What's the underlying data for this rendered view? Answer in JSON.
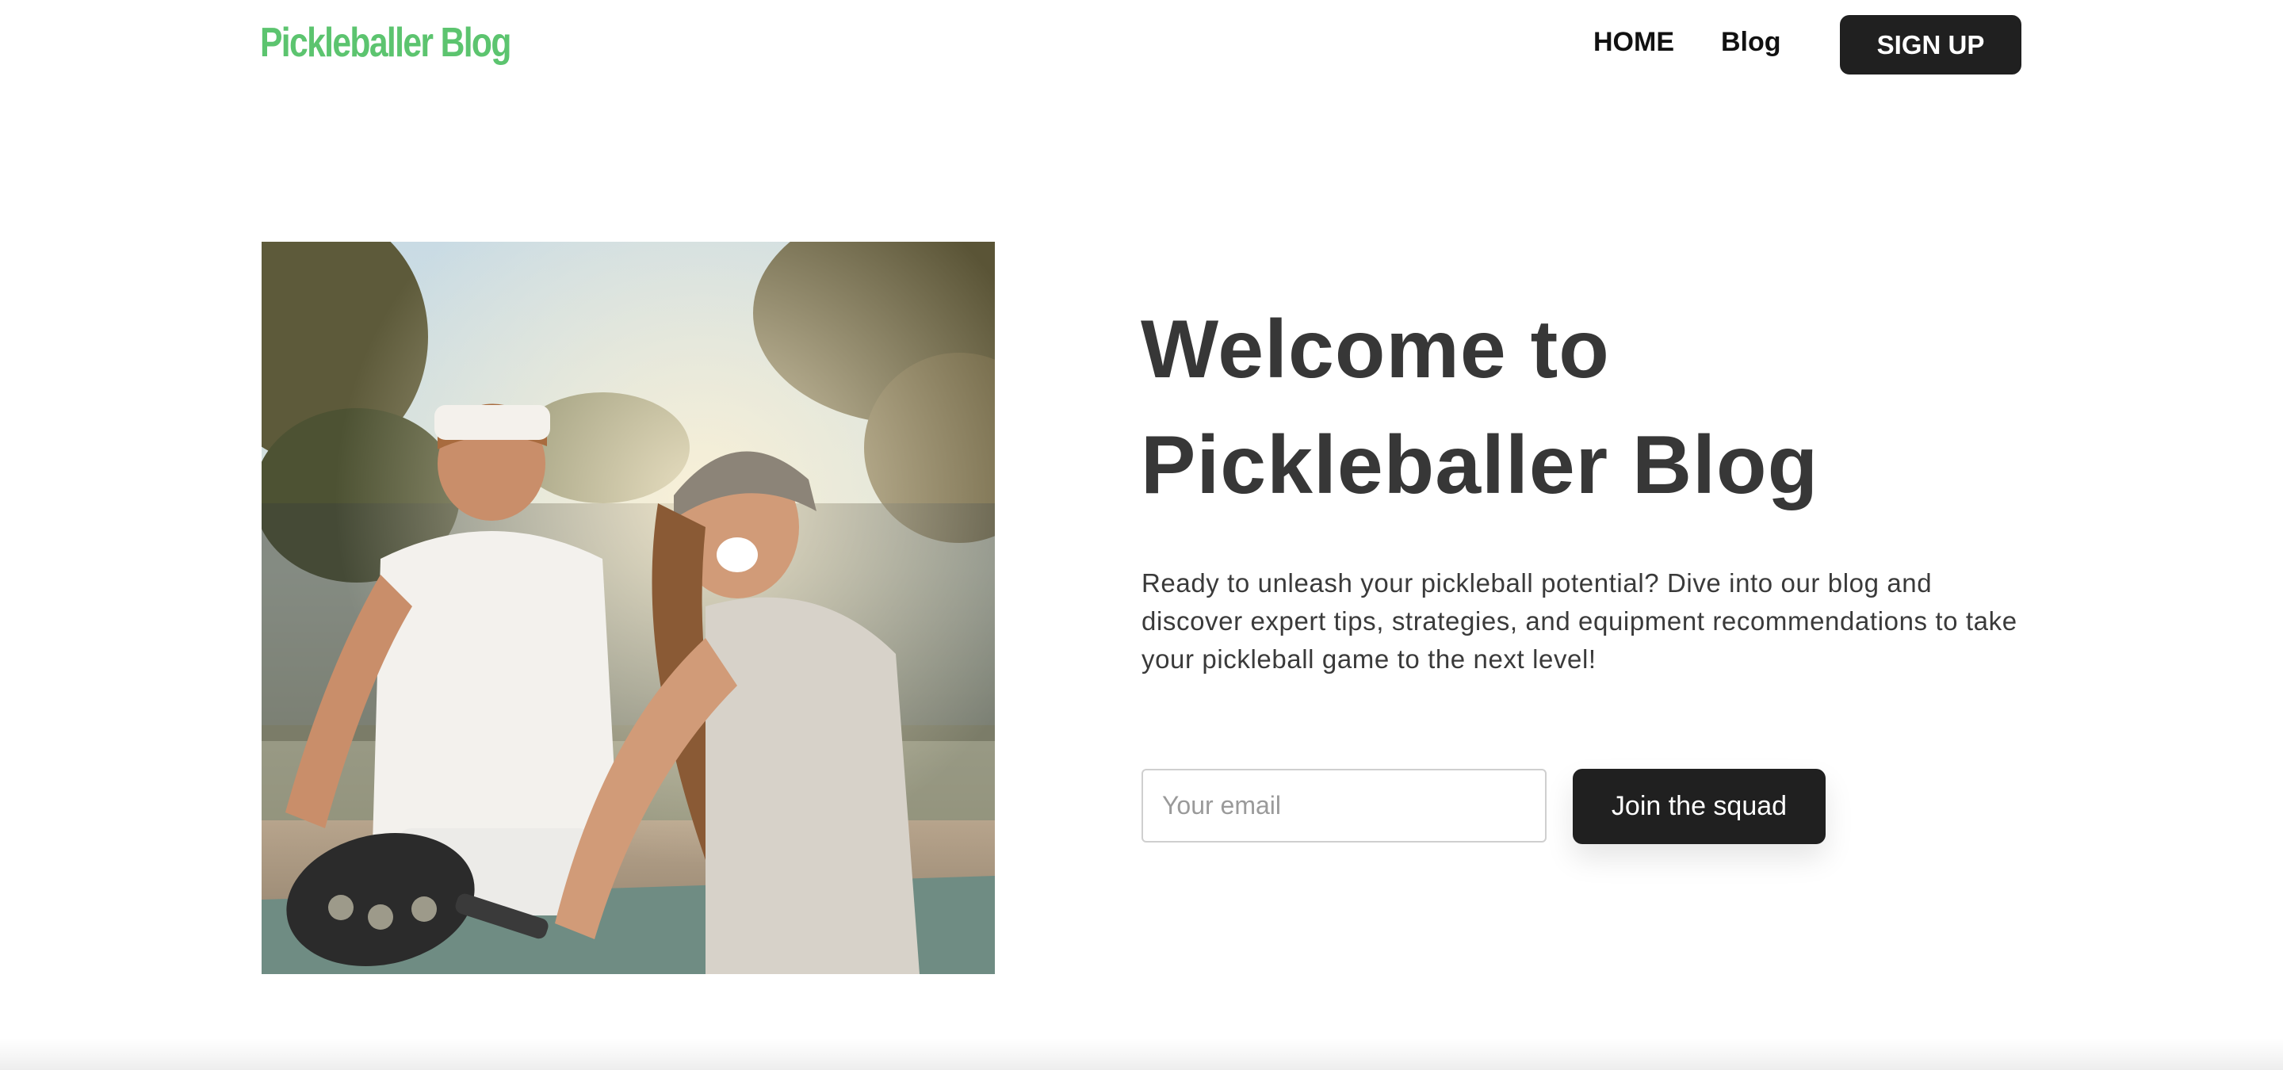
{
  "header": {
    "logo_text": "Pickleballer Blog",
    "nav": {
      "home_label": "HOME",
      "blog_label": "Blog",
      "signup_label": "SIGN UP"
    }
  },
  "hero": {
    "title_line1": "Welcome to",
    "title_line2": "Pickleballer Blog",
    "description": "Ready to unleash your pickleball potential? Dive into our blog and discover expert tips, strategies, and equipment recommendations to take your pickleball game to the next level!",
    "image_alt": "Two smiling pickleball players on a court"
  },
  "signup_form": {
    "email_placeholder": "Your email",
    "email_value": "",
    "submit_label": "Join the squad"
  },
  "colors": {
    "brand_green": "#5cc46f",
    "button_dark": "#202020",
    "heading_text": "#373737"
  }
}
